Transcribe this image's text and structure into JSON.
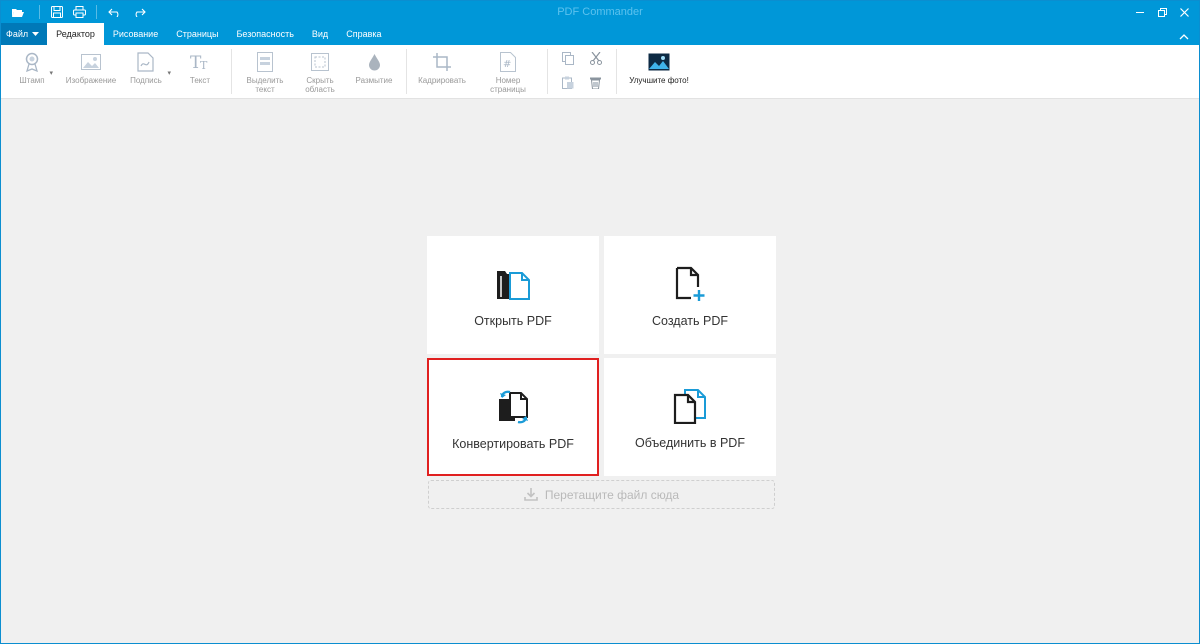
{
  "window": {
    "title": "PDF Commander"
  },
  "quick_access": {
    "icons": [
      "folder-open-icon",
      "save-icon",
      "print-icon",
      "undo-icon",
      "redo-icon"
    ]
  },
  "tabs": {
    "file_label": "Файл",
    "items": [
      {
        "label": "Редактор",
        "active": true
      },
      {
        "label": "Рисование",
        "active": false
      },
      {
        "label": "Страницы",
        "active": false
      },
      {
        "label": "Безопасность",
        "active": false
      },
      {
        "label": "Вид",
        "active": false
      },
      {
        "label": "Справка",
        "active": false
      }
    ]
  },
  "ribbon": {
    "stamp": "Штамп",
    "image": "Изображение",
    "signature": "Подпись",
    "text": "Текст",
    "highlight_line1": "Выделить",
    "highlight_line2": "текст",
    "hide_line1": "Скрыть",
    "hide_line2": "область",
    "blur": "Размытие",
    "crop": "Кадрировать",
    "pagenum_line1": "Номер",
    "pagenum_line2": "страницы",
    "enhance": "Улучшите фото!"
  },
  "start": {
    "open": "Открыть PDF",
    "create": "Создать PDF",
    "convert": "Конвертировать PDF",
    "merge": "Объединить в PDF",
    "drop": "Перетащите файл сюда"
  },
  "colors": {
    "titlebar": "#0097d8",
    "accent": "#1a9bd7",
    "highlight_border": "#e02020"
  }
}
